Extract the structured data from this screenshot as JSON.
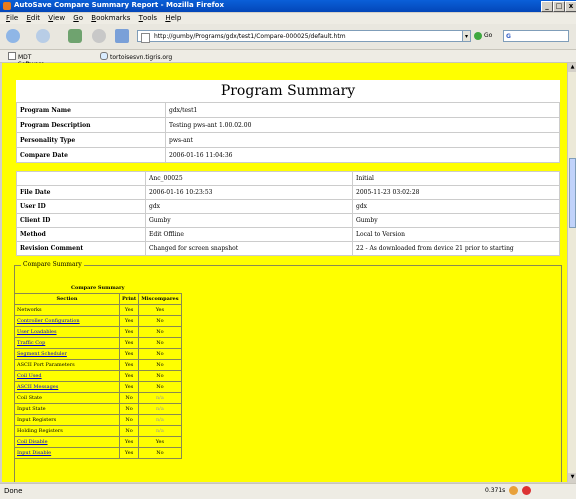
{
  "window": {
    "title": "AutoSave Compare Summary Report - Mozilla Firefox",
    "min": "_",
    "max": "□",
    "close": "x"
  },
  "menu": [
    {
      "label": "File",
      "key": "F",
      "rest": "ile"
    },
    {
      "label": "Edit",
      "key": "E",
      "rest": "dit"
    },
    {
      "label": "View",
      "key": "V",
      "rest": "iew"
    },
    {
      "label": "Go",
      "key": "G",
      "rest": "o"
    },
    {
      "label": "Bookmarks",
      "key": "B",
      "rest": "ookmarks"
    },
    {
      "label": "Tools",
      "key": "T",
      "rest": "ools"
    },
    {
      "label": "Help",
      "key": "H",
      "rest": "elp"
    }
  ],
  "nav": {
    "url": "http://gumby/Programs/gdx/test1/Compare-000025/default.htm",
    "go_label": "Go",
    "search_value": "G"
  },
  "bookmarks": [
    "MDT Software Intern...",
    "tortoisesvn.tigris.org"
  ],
  "program_summary": {
    "title": "Program Summary",
    "rows": [
      {
        "label": "Program Name",
        "value": "gdx/test1"
      },
      {
        "label": "Program Description",
        "value": "Testing pws-ant 1.00.02.00"
      },
      {
        "label": "Personality Type",
        "value": "pws-ant"
      },
      {
        "label": "Compare Date",
        "value": "2006-01-16 11:04:36"
      }
    ]
  },
  "compare_table": {
    "header": [
      "",
      "Anc_00025",
      "Initial"
    ],
    "rows": [
      {
        "label": "File Date",
        "a": "2006-01-16 10:23:53",
        "b": "2005-11-23 03:02:28"
      },
      {
        "label": "User ID",
        "a": "gdx",
        "b": "gdx"
      },
      {
        "label": "Client ID",
        "a": "Gumby",
        "b": "Gumby"
      },
      {
        "label": "Method",
        "a": "Edit Offline",
        "b": "Local to Version"
      },
      {
        "label": "Revision Comment",
        "a": "Changed for screen snapshot",
        "b": "22 - As downloaded from device 21 prior to starting"
      }
    ]
  },
  "compare_summary": {
    "legend": "Compare Summary",
    "caption": "Compare Summary",
    "headers": [
      "Section",
      "Print",
      "Miscompares"
    ],
    "rows": [
      {
        "section": "Networks",
        "link": false,
        "print": "Yes",
        "misc": "Yes",
        "gray": false
      },
      {
        "section": "Controller Configuration",
        "link": true,
        "print": "Yes",
        "misc": "No",
        "gray": false
      },
      {
        "section": "User Loadables",
        "link": true,
        "print": "Yes",
        "misc": "No",
        "gray": false
      },
      {
        "section": "Traffic Cop",
        "link": true,
        "print": "Yes",
        "misc": "No",
        "gray": false
      },
      {
        "section": "Segment Scheduler",
        "link": true,
        "print": "Yes",
        "misc": "No",
        "gray": false
      },
      {
        "section": "ASCII Port Parameters",
        "link": false,
        "print": "Yes",
        "misc": "No",
        "gray": false
      },
      {
        "section": "Coil Used",
        "link": true,
        "print": "Yes",
        "misc": "No",
        "gray": false
      },
      {
        "section": "ASCII Messages",
        "link": true,
        "print": "Yes",
        "misc": "No",
        "gray": false
      },
      {
        "section": "Coil State",
        "link": false,
        "print": "No",
        "misc": "n/a",
        "gray": true
      },
      {
        "section": "Input State",
        "link": false,
        "print": "No",
        "misc": "n/a",
        "gray": true
      },
      {
        "section": "Input Registers",
        "link": false,
        "print": "No",
        "misc": "n/a",
        "gray": true
      },
      {
        "section": "Holding Registers",
        "link": false,
        "print": "No",
        "misc": "n/a",
        "gray": true
      },
      {
        "section": "Coil Disable",
        "link": true,
        "print": "Yes",
        "misc": "Yes",
        "gray": false
      },
      {
        "section": "Input Disable",
        "link": true,
        "print": "Yes",
        "misc": "No",
        "gray": false
      }
    ]
  },
  "status": {
    "text": "Done",
    "timer": "0.371s"
  }
}
